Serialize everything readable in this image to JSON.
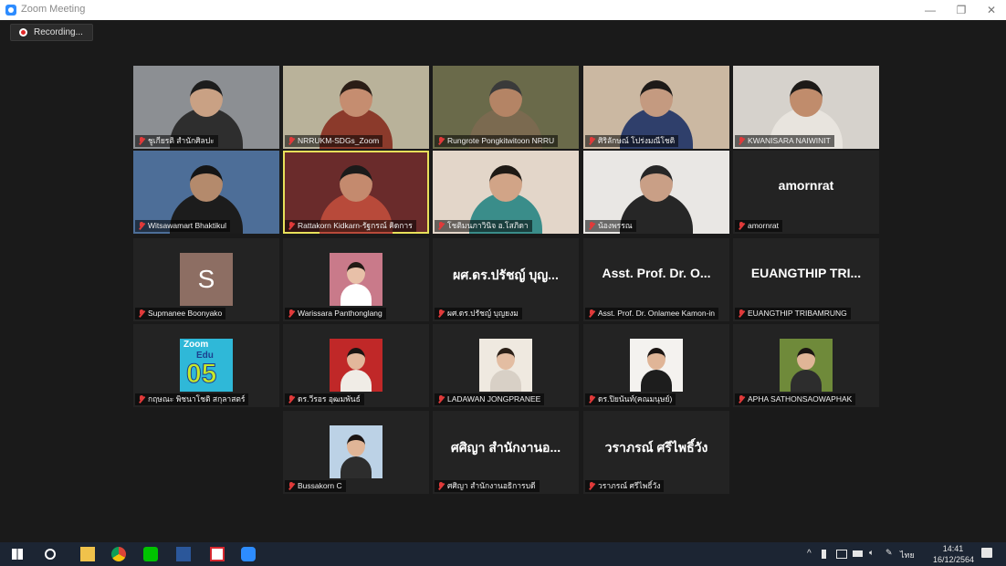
{
  "window": {
    "title": "Zoom Meeting",
    "min": "—",
    "max": "❐",
    "close": "✕"
  },
  "recording": {
    "label": "Recording..."
  },
  "participants": [
    {
      "name": "ชูเกียรติ สำนักศิลปะ",
      "kind": "video",
      "bg": "#8c8f93",
      "skin": "#c9a184",
      "shirt": "#2e2e2e",
      "hair": "#1d1d1d"
    },
    {
      "name": "NRRUKM-SDGs_Zoom",
      "kind": "video",
      "bg": "#b9b29a",
      "skin": "#c58d70",
      "shirt": "#8b3a2b",
      "hair": "#2a1d16"
    },
    {
      "name": "Rungrote Pongkitwitoon NRRU",
      "kind": "video",
      "bg": "#6a6a4a",
      "skin": "#b48465",
      "shirt": "#7b6a50",
      "hair": "#3a3a3a"
    },
    {
      "name": "ศิริลักษณ์ โปร่งมณีโชติ",
      "kind": "video",
      "bg": "#cbb8a2",
      "skin": "#c49a80",
      "shirt": "#2f3f6b",
      "hair": "#1e1a18"
    },
    {
      "name": "KWANISARA NAIWINIT",
      "kind": "video",
      "bg": "#d6d2cc",
      "skin": "#c08c6c",
      "shirt": "#e8e4de",
      "hair": "#1d1a18"
    },
    {
      "name": "Witsawamart Bhaktikul",
      "kind": "video",
      "bg": "#4d6e98",
      "skin": "#b48a6c",
      "shirt": "#1c1c1c",
      "hair": "#151515"
    },
    {
      "name": "Rattakorn Kidkarn-รัฐกรณ์ คิดการ",
      "kind": "video",
      "bg": "#6a2b2b",
      "skin": "#c48a6e",
      "shirt": "#b84a3a",
      "hair": "#1a1a1a",
      "active": true
    },
    {
      "name": "โชติมนภาวินิจ อ.โสภิดา",
      "kind": "video",
      "bg": "#e3d6c9",
      "skin": "#d1a487",
      "shirt": "#3a8d8a",
      "hair": "#1e1914"
    },
    {
      "name": "น้องพรรณ",
      "kind": "video",
      "bg": "#e9e7e4",
      "skin": "#c99f86",
      "shirt": "#262626",
      "hair": "#262626"
    },
    {
      "name": "amornrat",
      "kind": "text",
      "display": "amornrat"
    },
    {
      "name": "Supmanee Boonyako",
      "kind": "avatar",
      "initial": "S"
    },
    {
      "name": "Warissara Panthonglang",
      "kind": "photo",
      "bg": "#c97a8a",
      "skin": "#e8c0a8",
      "shirt": "#ffffff",
      "hair": "#231a15"
    },
    {
      "name": "ผศ.ดร.ปรัชญ์ บุญยงม",
      "kind": "text",
      "display": "ผศ.ดร.ปรัชญ์ บุญ..."
    },
    {
      "name": "Asst. Prof. Dr. Onlamee Kamon-in",
      "kind": "text",
      "display": "Asst. Prof. Dr. O..."
    },
    {
      "name": "EUANGTHIP TRIBAMRUNG",
      "kind": "text",
      "display": "EUANGTHIP TRI..."
    },
    {
      "name": "กฤษณะ พิชนาโชติ สกุลาสตร์",
      "kind": "zoomlogo",
      "top": "Zoom",
      "mid": "Edu",
      "num": "05"
    },
    {
      "name": "ดร.วีรอร อุฒมพันธ์",
      "kind": "photo",
      "bg": "#c02828",
      "skin": "#e2b79b",
      "shirt": "#f0ece6",
      "hair": "#1a1412"
    },
    {
      "name": "LADAWAN JONGPRANEE",
      "kind": "photo",
      "bg": "#efe9e0",
      "skin": "#e3bda2",
      "shirt": "#d8d0c6",
      "hair": "#2a1f17"
    },
    {
      "name": "ดร.ปิยนันท์(คณมนุษย์)",
      "kind": "photo",
      "bg": "#f4f2ef",
      "skin": "#e0b597",
      "shirt": "#1d1d1d",
      "hair": "#1a1412"
    },
    {
      "name": "APHA SATHONSAOWAPHAK",
      "kind": "photo",
      "bg": "#6f8a3a",
      "skin": "#e0b597",
      "shirt": "#2d2d2d",
      "hair": "#1a1412"
    },
    {
      "name": "Bussakorn C",
      "kind": "photo",
      "bg": "#bcd2e6",
      "skin": "#e0b597",
      "shirt": "#2d2d2d",
      "hair": "#1a1412"
    },
    {
      "name": "ศศิญา สำนักงานอธิการบดี",
      "kind": "text",
      "display": "ศศิญา สำนักงานอ..."
    },
    {
      "name": "วราภรณ์ ศรีไพธิ์วัง",
      "kind": "text",
      "display": "วราภรณ์ ศรีไพธิ์วัง"
    }
  ],
  "taskbar": {
    "icons": [
      "windows-start-icon",
      "search-icon",
      "file-explorer-icon",
      "chrome-icon",
      "line-icon",
      "word-icon",
      "acrobat-icon",
      "zoom-icon"
    ],
    "tray": {
      "lang": "ไทย",
      "time": "14:41",
      "date": "16/12/2564"
    }
  }
}
